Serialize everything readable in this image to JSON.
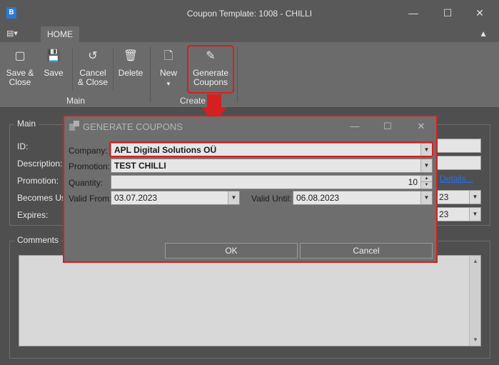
{
  "window": {
    "title": "Coupon Template: 1008 - CHILLI",
    "app_icon": "B",
    "minimize_icon": "minimize-icon",
    "maximize_icon": "maximize-icon",
    "close_icon": "close-icon"
  },
  "ribbon": {
    "tab_home": "HOME",
    "buttons": {
      "save_close": "Save &\nClose",
      "save": "Save",
      "cancel_close": "Cancel\n& Close",
      "delete": "Delete",
      "new": "New",
      "generate_coupons": "Generate\nCoupons"
    },
    "groups": {
      "main": "Main",
      "create": "Create"
    }
  },
  "form": {
    "main_group_title": "Main",
    "labels": {
      "id": "ID:",
      "description": "Description:",
      "promotion": "Promotion:",
      "becomes_usable": "Becomes Usa",
      "expires": "Expires:"
    },
    "details_link": "Details...",
    "becomes_usable_year": "23",
    "expires_year": "23",
    "comments_title": "Comments"
  },
  "dialog": {
    "title": "GENERATE COUPONS",
    "labels": {
      "company": "Company:",
      "promotion": "Promotion:",
      "quantity": "Quantity:",
      "valid_from": "Valid From:",
      "valid_until": "Valid Until:"
    },
    "values": {
      "company": "APL Digital Solutions OÜ",
      "promotion": "TEST CHILLI",
      "quantity": "10",
      "valid_from": "03.07.2023",
      "valid_until": "06.08.2023"
    },
    "ok_label": "OK",
    "cancel_label": "Cancel"
  },
  "colors": {
    "highlight": "#d61f1f",
    "link": "#2d6fe0",
    "app_icon": "#2b78d6"
  }
}
